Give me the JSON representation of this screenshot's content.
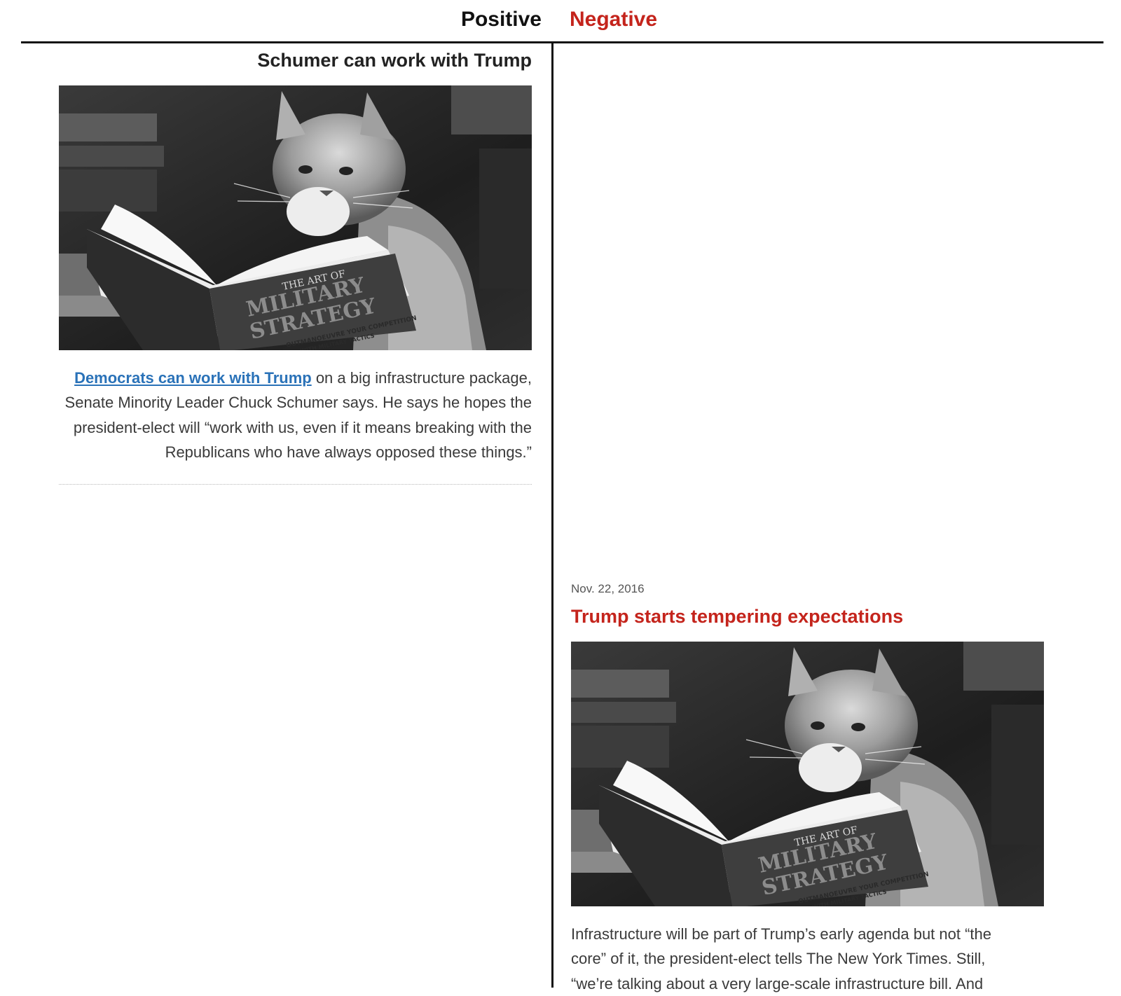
{
  "header": {
    "positive_label": "Positive",
    "negative_label": "Negative"
  },
  "positive_card": {
    "title": "Schumer can work with Trump",
    "link_text": "Democrats can work with Trump",
    "body_rest": " on a big infrastructure package, Senate Minority Leader Chuck Schumer says. He says he hopes the president-elect will “work with us, even if it means breaking with the Republicans who have always opposed these things.”",
    "image_book_line1": "THE ART OF",
    "image_book_line2": "MILITARY",
    "image_book_line3": "STRATEGY",
    "image_book_line4": "OUTMANOEUVRE YOUR COMPETITION",
    "image_book_line5": "WITH MILITARY TACTICS"
  },
  "negative_card": {
    "date": "Nov. 22, 2016",
    "title": "Trump starts tempering expectations",
    "body": "Infrastructure will be part of Trump’s early agenda but not “the core” of it, the president-elect tells The New York Times. Still, “we’re talking about a very large-scale infrastructure bill. And",
    "image_book_line1": "THE ART OF",
    "image_book_line2": "MILITARY",
    "image_book_line3": "STRATEGY",
    "image_book_line4": "OUTMANOEUVRE YOUR COMPETITION",
    "image_book_line5": "WITH MILITARY TACTICS"
  },
  "colors": {
    "negative": "#c4241c",
    "link": "#2a72b8",
    "rule": "#111111"
  },
  "icons": [
    "cat-reading-photo"
  ]
}
